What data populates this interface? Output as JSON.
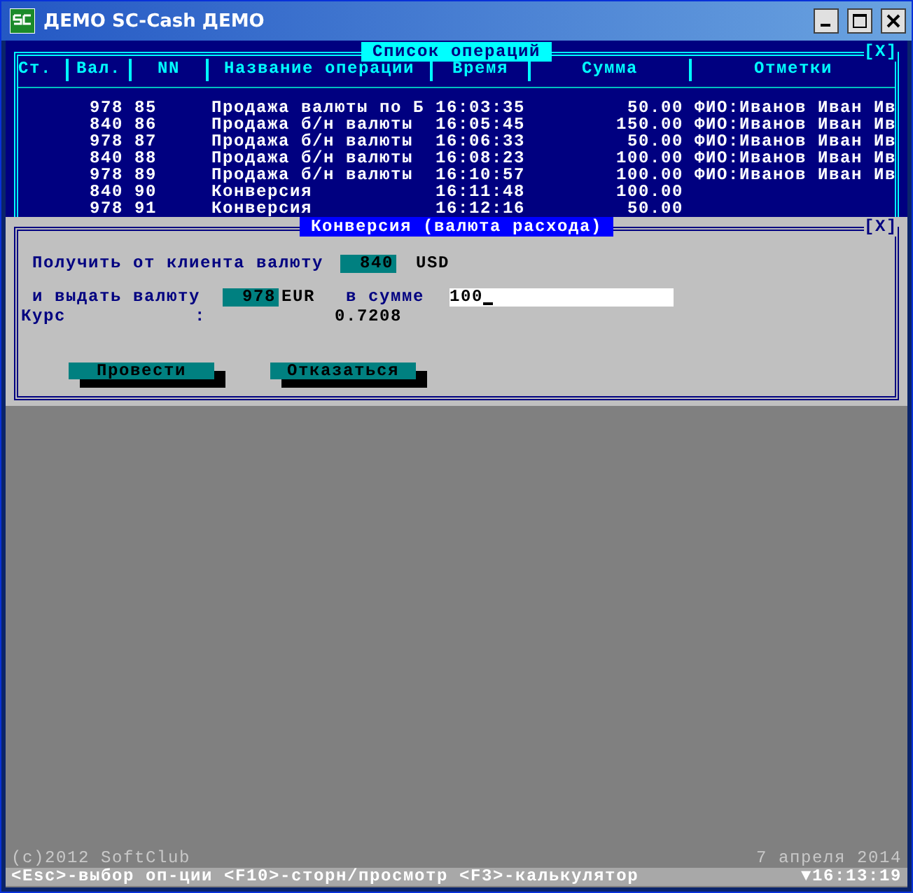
{
  "window": {
    "title": "ДЕМО SC-Cash ДЕМО"
  },
  "operations_panel": {
    "title": "Список операций",
    "close": "[X]",
    "columns": [
      "Ст.",
      "Вал.",
      "NN",
      "Название операции",
      "Время",
      "Сумма",
      "Отметки"
    ],
    "rows": [
      {
        "currency": "978",
        "nn": "85",
        "name": "Продажа валюты по Б",
        "time": "16:03:35",
        "amount": "50.00",
        "notes": "ФИО:Иванов Иван Ив"
      },
      {
        "currency": "840",
        "nn": "86",
        "name": "Продажа б/н валюты",
        "time": "16:05:45",
        "amount": "150.00",
        "notes": "ФИО:Иванов Иван Ив"
      },
      {
        "currency": "978",
        "nn": "87",
        "name": "Продажа б/н валюты",
        "time": "16:06:33",
        "amount": "50.00",
        "notes": "ФИО:Иванов Иван Ив"
      },
      {
        "currency": "840",
        "nn": "88",
        "name": "Продажа б/н валюты",
        "time": "16:08:23",
        "amount": "100.00",
        "notes": "ФИО:Иванов Иван Ив"
      },
      {
        "currency": "978",
        "nn": "89",
        "name": "Продажа б/н валюты",
        "time": "16:10:57",
        "amount": "100.00",
        "notes": "ФИО:Иванов Иван Ив"
      },
      {
        "currency": "840",
        "nn": "90",
        "name": "Конверсия",
        "time": "16:11:48",
        "amount": "100.00"
      },
      {
        "currency": "978",
        "nn": "91",
        "name": "Конверсия",
        "time": "16:12:16",
        "amount": "50.00"
      }
    ]
  },
  "conversion_dialog": {
    "title": "Конверсия (валюта расхода)",
    "close": "[X]",
    "receive_label": "Получить от клиента валюту",
    "receive_code": "840",
    "receive_name": "USD",
    "give_label": "и выдать валюту",
    "give_code": "978",
    "give_name": "EUR",
    "amount_label": "в сумме",
    "amount_value": "100",
    "rate_label": "Курс",
    "rate_colon": ":",
    "rate_value": "0.7208",
    "buttons": [
      "Провести",
      "Отказаться"
    ]
  },
  "footer": {
    "copyright": "(c)2012 SoftClub",
    "date": "7 апреля 2014"
  },
  "status_bar": {
    "hints": "<Esc>-выбор оп-ции <F10>-сторн/просмотр <F3>-калькулятор",
    "time": "▼16:13:19"
  }
}
